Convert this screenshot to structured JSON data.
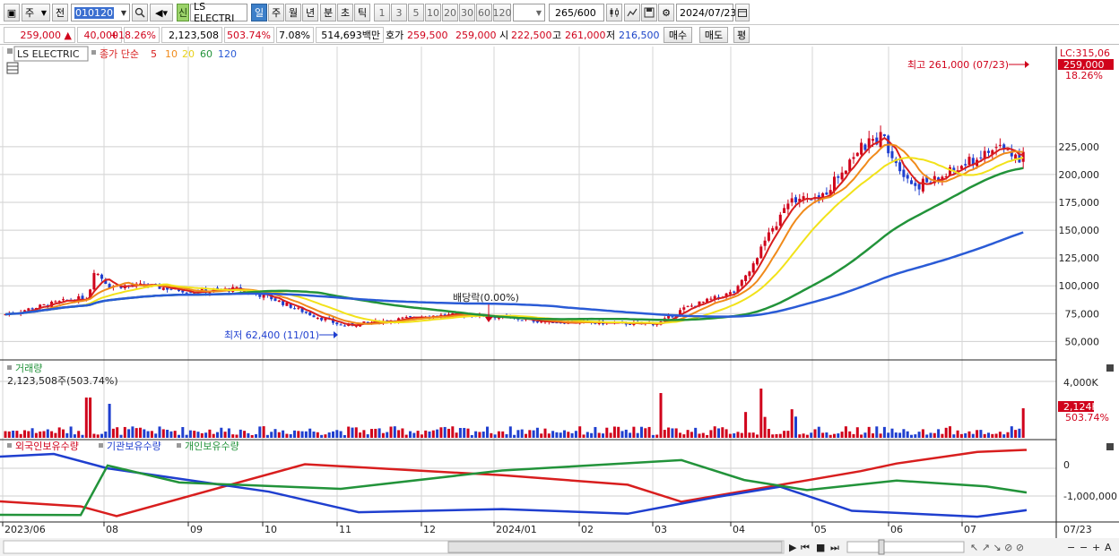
{
  "toolbar": {
    "market_label": "주",
    "prev_label": "전",
    "stock_code": "010120",
    "stock_name": "LS ELECTRI",
    "credit_badge": "신",
    "periods": [
      "일",
      "주",
      "월",
      "년",
      "분",
      "초",
      "틱"
    ],
    "active_period": "일",
    "intervals": [
      "1",
      "3",
      "5",
      "10",
      "20",
      "30",
      "60",
      "120"
    ],
    "count": "265",
    "count_max": "/600",
    "date": "2024/07/23"
  },
  "quote": {
    "price": "259,000 ▲",
    "change": "40,000",
    "change_pct": "+18.26%",
    "volume": "2,123,508",
    "volume_ratio": "503.74%",
    "turnover": "7.08%",
    "amount": "514,693백만",
    "bid_label": "호가",
    "bid1": "259,500",
    "bid2": "259,000",
    "open_label": "시",
    "open": "222,500",
    "high_label": "고",
    "high": "261,000",
    "low_label": "저",
    "low": "216,500",
    "buy_label": "매수",
    "sell_label": "매도",
    "eval_label": "평"
  },
  "legend": {
    "name": "LS ELECTRIC",
    "title": "종가 단순",
    "ma": [
      "5",
      "10",
      "20",
      "60",
      "120"
    ]
  },
  "annotations": {
    "high": "최고 261,000 (07/23)",
    "low": "최저 62,400 (11/01)",
    "dividend": "배당락(0.00%)",
    "lc": "LC:315,06",
    "last_price": "259,000",
    "last_pct": "18.26%"
  },
  "volume_panel": {
    "title": "거래량",
    "value": "2,123,508주(503.74%)",
    "axis": "4,000K",
    "last": "2,124K",
    "last_pct": "503.74%"
  },
  "holding_panel": {
    "series": [
      "외국인보유수량",
      "기관보유수량",
      "개인보유수량"
    ],
    "axis": [
      "0",
      "-1,000,000"
    ]
  },
  "x_labels": [
    "2023/06",
    "08",
    "09",
    "10",
    "11",
    "12",
    "2024/01",
    "02",
    "03",
    "04",
    "05",
    "06",
    "07"
  ],
  "x_last": "07/23",
  "colors": {
    "up": "#d0021b",
    "down": "#1f3fcf",
    "ma5": "#d81e1e",
    "ma10": "#f08a1a",
    "ma20": "#f2e21a",
    "ma60": "#22933a",
    "ma120": "#2a5bd6"
  },
  "chart_data": {
    "type": "candlestick",
    "y_ticks": [
      50000,
      75000,
      100000,
      125000,
      150000,
      175000,
      200000,
      225000
    ],
    "ylim": [
      50000,
      315000
    ],
    "key_points": [
      {
        "date": "2023/06",
        "close": 74000
      },
      {
        "date": "2023/08",
        "close": 100000
      },
      {
        "date": "2023/10",
        "close": 96000
      },
      {
        "date": "2023/11/01",
        "low": 62400
      },
      {
        "date": "2024/01",
        "close": 73000
      },
      {
        "date": "2024/03",
        "close": 66000
      },
      {
        "date": "2024/04",
        "close": 95000
      },
      {
        "date": "2024/05",
        "close": 230000
      },
      {
        "date": "2024/06",
        "close": 190000
      },
      {
        "date": "2024/07/23",
        "close": 259000,
        "high": 261000
      }
    ]
  }
}
